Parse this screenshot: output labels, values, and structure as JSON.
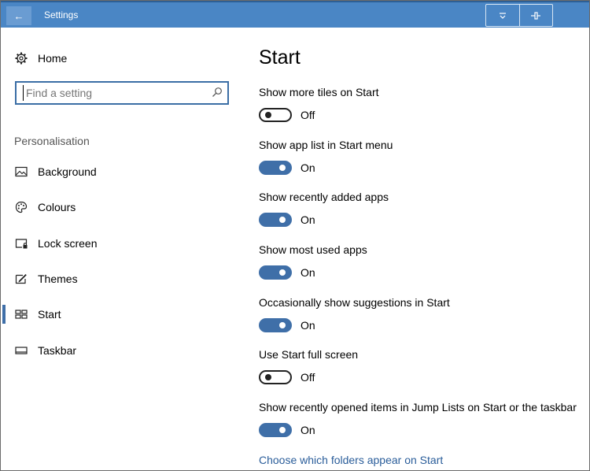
{
  "window": {
    "title": "Settings",
    "back_glyph": "←",
    "controls": [
      "restore-icon",
      "pin-icon"
    ]
  },
  "sidebar": {
    "home_label": "Home",
    "search": {
      "value": "",
      "placeholder": "Find a setting"
    },
    "section": "Personalisation",
    "items": [
      {
        "label": "Background",
        "icon": "picture-icon"
      },
      {
        "label": "Colours",
        "icon": "palette-icon"
      },
      {
        "label": "Lock screen",
        "icon": "lock-screen-icon"
      },
      {
        "label": "Themes",
        "icon": "themes-icon"
      },
      {
        "label": "Start",
        "icon": "start-icon",
        "active": true
      },
      {
        "label": "Taskbar",
        "icon": "taskbar-icon"
      }
    ]
  },
  "main": {
    "title": "Start",
    "settings": [
      {
        "label": "Show more tiles on Start",
        "on": false,
        "state": "Off"
      },
      {
        "label": "Show app list in Start menu",
        "on": true,
        "state": "On"
      },
      {
        "label": "Show recently added apps",
        "on": true,
        "state": "On"
      },
      {
        "label": "Show most used apps",
        "on": true,
        "state": "On"
      },
      {
        "label": "Occasionally show suggestions in Start",
        "on": true,
        "state": "On"
      },
      {
        "label": "Use Start full screen",
        "on": false,
        "state": "Off"
      },
      {
        "label": "Show recently opened items in Jump Lists on Start or the taskbar",
        "on": true,
        "state": "On"
      }
    ],
    "link": "Choose which folders appear on Start"
  },
  "colors": {
    "titlebar": "#4a86c5",
    "accent": "#3f6fa8",
    "link": "#2a5d9a"
  }
}
